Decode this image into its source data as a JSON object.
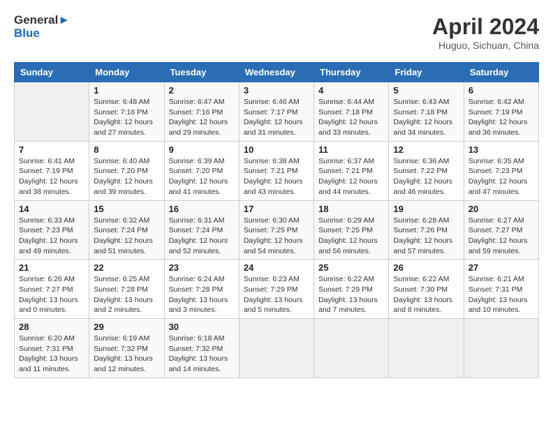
{
  "header": {
    "logo": {
      "line1": "General",
      "line2": "Blue"
    },
    "title": "April 2024",
    "location": "Huguo, Sichuan, China"
  },
  "weekdays": [
    "Sunday",
    "Monday",
    "Tuesday",
    "Wednesday",
    "Thursday",
    "Friday",
    "Saturday"
  ],
  "weeks": [
    [
      {
        "day": "",
        "info": ""
      },
      {
        "day": "1",
        "info": "Sunrise: 6:48 AM\nSunset: 7:16 PM\nDaylight: 12 hours\nand 27 minutes."
      },
      {
        "day": "2",
        "info": "Sunrise: 6:47 AM\nSunset: 7:16 PM\nDaylight: 12 hours\nand 29 minutes."
      },
      {
        "day": "3",
        "info": "Sunrise: 6:46 AM\nSunset: 7:17 PM\nDaylight: 12 hours\nand 31 minutes."
      },
      {
        "day": "4",
        "info": "Sunrise: 6:44 AM\nSunset: 7:18 PM\nDaylight: 12 hours\nand 33 minutes."
      },
      {
        "day": "5",
        "info": "Sunrise: 6:43 AM\nSunset: 7:18 PM\nDaylight: 12 hours\nand 34 minutes."
      },
      {
        "day": "6",
        "info": "Sunrise: 6:42 AM\nSunset: 7:19 PM\nDaylight: 12 hours\nand 36 minutes."
      }
    ],
    [
      {
        "day": "7",
        "info": "Sunrise: 6:41 AM\nSunset: 7:19 PM\nDaylight: 12 hours\nand 38 minutes."
      },
      {
        "day": "8",
        "info": "Sunrise: 6:40 AM\nSunset: 7:20 PM\nDaylight: 12 hours\nand 39 minutes."
      },
      {
        "day": "9",
        "info": "Sunrise: 6:39 AM\nSunset: 7:20 PM\nDaylight: 12 hours\nand 41 minutes."
      },
      {
        "day": "10",
        "info": "Sunrise: 6:38 AM\nSunset: 7:21 PM\nDaylight: 12 hours\nand 43 minutes."
      },
      {
        "day": "11",
        "info": "Sunrise: 6:37 AM\nSunset: 7:21 PM\nDaylight: 12 hours\nand 44 minutes."
      },
      {
        "day": "12",
        "info": "Sunrise: 6:36 AM\nSunset: 7:22 PM\nDaylight: 12 hours\nand 46 minutes."
      },
      {
        "day": "13",
        "info": "Sunrise: 6:35 AM\nSunset: 7:23 PM\nDaylight: 12 hours\nand 47 minutes."
      }
    ],
    [
      {
        "day": "14",
        "info": "Sunrise: 6:33 AM\nSunset: 7:23 PM\nDaylight: 12 hours\nand 49 minutes."
      },
      {
        "day": "15",
        "info": "Sunrise: 6:32 AM\nSunset: 7:24 PM\nDaylight: 12 hours\nand 51 minutes."
      },
      {
        "day": "16",
        "info": "Sunrise: 6:31 AM\nSunset: 7:24 PM\nDaylight: 12 hours\nand 52 minutes."
      },
      {
        "day": "17",
        "info": "Sunrise: 6:30 AM\nSunset: 7:25 PM\nDaylight: 12 hours\nand 54 minutes."
      },
      {
        "day": "18",
        "info": "Sunrise: 6:29 AM\nSunset: 7:25 PM\nDaylight: 12 hours\nand 56 minutes."
      },
      {
        "day": "19",
        "info": "Sunrise: 6:28 AM\nSunset: 7:26 PM\nDaylight: 12 hours\nand 57 minutes."
      },
      {
        "day": "20",
        "info": "Sunrise: 6:27 AM\nSunset: 7:27 PM\nDaylight: 12 hours\nand 59 minutes."
      }
    ],
    [
      {
        "day": "21",
        "info": "Sunrise: 6:26 AM\nSunset: 7:27 PM\nDaylight: 13 hours\nand 0 minutes."
      },
      {
        "day": "22",
        "info": "Sunrise: 6:25 AM\nSunset: 7:28 PM\nDaylight: 13 hours\nand 2 minutes."
      },
      {
        "day": "23",
        "info": "Sunrise: 6:24 AM\nSunset: 7:28 PM\nDaylight: 13 hours\nand 3 minutes."
      },
      {
        "day": "24",
        "info": "Sunrise: 6:23 AM\nSunset: 7:29 PM\nDaylight: 13 hours\nand 5 minutes."
      },
      {
        "day": "25",
        "info": "Sunrise: 6:22 AM\nSunset: 7:29 PM\nDaylight: 13 hours\nand 7 minutes."
      },
      {
        "day": "26",
        "info": "Sunrise: 6:22 AM\nSunset: 7:30 PM\nDaylight: 13 hours\nand 8 minutes."
      },
      {
        "day": "27",
        "info": "Sunrise: 6:21 AM\nSunset: 7:31 PM\nDaylight: 13 hours\nand 10 minutes."
      }
    ],
    [
      {
        "day": "28",
        "info": "Sunrise: 6:20 AM\nSunset: 7:31 PM\nDaylight: 13 hours\nand 11 minutes."
      },
      {
        "day": "29",
        "info": "Sunrise: 6:19 AM\nSunset: 7:32 PM\nDaylight: 13 hours\nand 12 minutes."
      },
      {
        "day": "30",
        "info": "Sunrise: 6:18 AM\nSunset: 7:32 PM\nDaylight: 13 hours\nand 14 minutes."
      },
      {
        "day": "",
        "info": ""
      },
      {
        "day": "",
        "info": ""
      },
      {
        "day": "",
        "info": ""
      },
      {
        "day": "",
        "info": ""
      }
    ]
  ]
}
